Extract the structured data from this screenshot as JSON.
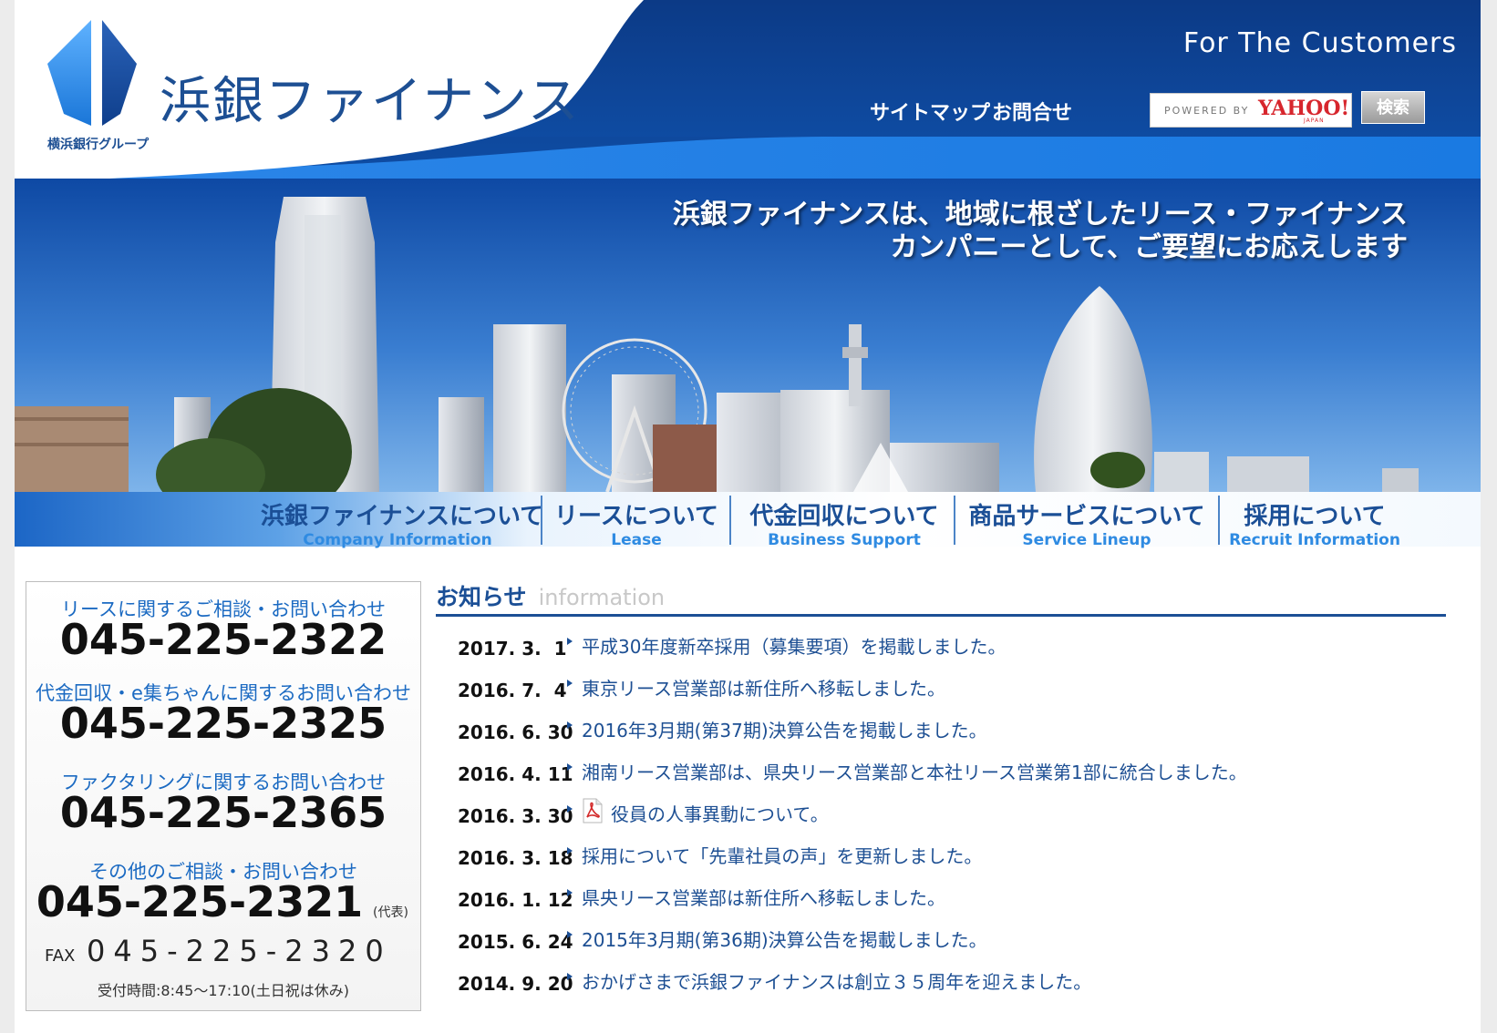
{
  "header": {
    "logo_text": "浜銀ファイナンス",
    "logo_sub": "横浜銀行グループ",
    "tagline": "For The Customers",
    "nav": [
      {
        "label": "サイトマップ"
      },
      {
        "label": "お問合せ"
      }
    ],
    "search": {
      "powered_by": "POWERED BY",
      "brand": "YAHOO!",
      "brand_sub": "JAPAN",
      "button_label": "検索"
    }
  },
  "hero": {
    "line1": "浜銀ファイナンスは、地域に根ざしたリース・ファイナンス",
    "line2": "カンパニーとして、ご要望にお応えします"
  },
  "main_nav": [
    {
      "jp": "浜銀ファイナンスについて",
      "en": "Company Information"
    },
    {
      "jp": "リースについて",
      "en": "Lease"
    },
    {
      "jp": "代金回収について",
      "en": "Business Support"
    },
    {
      "jp": "商品サービスについて",
      "en": "Service Lineup"
    },
    {
      "jp": "採用について",
      "en": "Recruit Information"
    }
  ],
  "contact": {
    "items": [
      {
        "label": "リースに関するご相談・お問い合わせ",
        "tel": "045-225-2322"
      },
      {
        "label": "代金回収・e集ちゃんに関するお問い合わせ",
        "tel": "045-225-2325"
      },
      {
        "label": "ファクタリングに関するお問い合わせ",
        "tel": "045-225-2365"
      },
      {
        "label": "その他のご相談・お問い合わせ",
        "tel": "045-225-2321"
      }
    ],
    "daihyo": "(代表)",
    "fax_label": "FAX",
    "fax": "045-225-2320",
    "hours": "受付時間:8:45〜17:10(土日祝は休み)"
  },
  "news": {
    "title_jp": "お知らせ",
    "title_en": "information",
    "items": [
      {
        "date": "2017. 3.  1",
        "text": "平成30年度新卒採用（募集要項）を掲載しました。",
        "pdf": false
      },
      {
        "date": "2016. 7.  4",
        "text": "東京リース営業部は新住所へ移転しました。",
        "pdf": false
      },
      {
        "date": "2016. 6. 30",
        "text": "2016年3月期(第37期)決算公告を掲載しました。",
        "pdf": false
      },
      {
        "date": "2016. 4. 11",
        "text": "湘南リース営業部は、県央リース営業部と本社リース営業第1部に統合しました。",
        "pdf": false
      },
      {
        "date": "2016. 3. 30",
        "text": "役員の人事異動について。",
        "pdf": true
      },
      {
        "date": "2016. 3. 18",
        "text": "採用について「先輩社員の声」を更新しました。",
        "pdf": false
      },
      {
        "date": "2016. 1. 12",
        "text": "県央リース営業部は新住所へ移転しました。",
        "pdf": false
      },
      {
        "date": "2015. 6. 24",
        "text": "2015年3月期(第36期)決算公告を掲載しました。",
        "pdf": false
      },
      {
        "date": "2014. 9. 20",
        "text": "おかげさまで浜銀ファイナンスは創立３５周年を迎えました。",
        "pdf": false
      }
    ]
  },
  "colors": {
    "brand_navy": "#0f3f8c",
    "brand_blue": "#1d4f93",
    "accent_blue": "#2f8be2",
    "yahoo_red": "#d7262d"
  }
}
